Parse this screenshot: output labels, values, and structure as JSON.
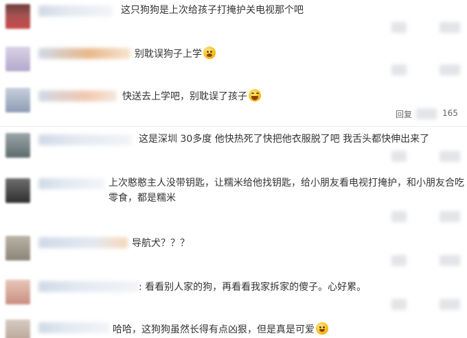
{
  "comments": [
    {
      "text": "这只狗狗是上次给孩子打掩护关电视那个吧"
    },
    {
      "text": "别耽误狗子上学",
      "emoji": "scared-face-icon"
    },
    {
      "text": "快送去上学吧，别耽误了孩子",
      "emoji": "laughing-face-icon"
    },
    {
      "text": "这是深圳 30多度 他快热死了快把他衣服脱了吧 我舌头都快伸出来了"
    },
    {
      "text": "上次憨憨主人没带钥匙，让糯米给他找钥匙，给小朋友看电视打掩护，和小朋友合吃零食，都是糯米"
    },
    {
      "text": "导航犬？？？"
    },
    {
      "text": ": 看看别人家的狗，再看看我家拆家的傻子。心好累。"
    },
    {
      "text": "哈哈，这狗狗虽然长得有点凶狠，但是真是可爱",
      "emoji": "smile-face-icon"
    }
  ],
  "reply": {
    "label": "回复",
    "count": "165"
  },
  "colors": {
    "text": "#333333",
    "separator": "#eeeeee",
    "blur": "#e2e4e7"
  }
}
